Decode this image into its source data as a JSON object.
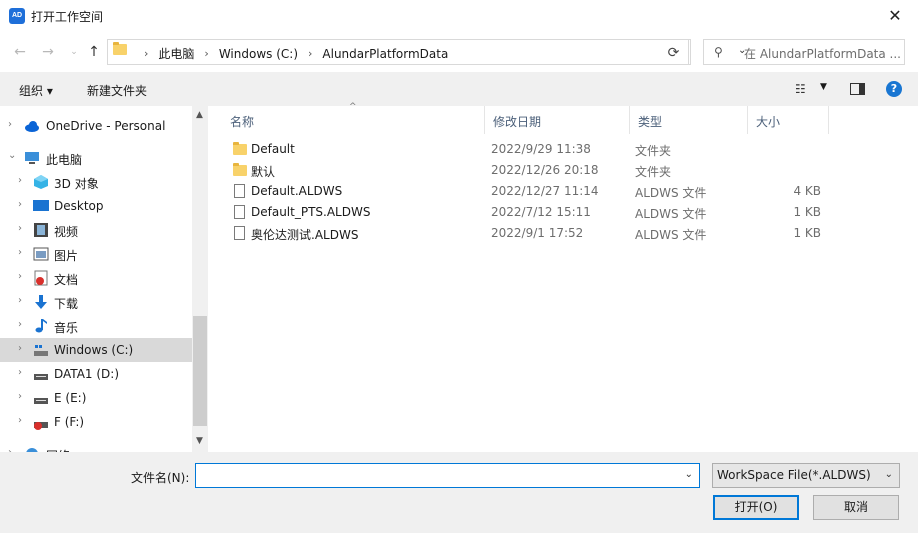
{
  "window": {
    "title": "打开工作空间",
    "app_badge": "AD",
    "close_glyph": "✕"
  },
  "nav": {
    "back": "←",
    "forward": "→",
    "up": "↑"
  },
  "address": {
    "crumbs": [
      "此电脑",
      "Windows (C:)",
      "AlundarPlatformData"
    ],
    "separator": "›",
    "refresh_glyph": "⟳"
  },
  "search": {
    "placeholder": "在 AlundarPlatformData ..."
  },
  "toolbar": {
    "organize": "组织 ▾",
    "new_folder": "新建文件夹",
    "help": "?"
  },
  "sidebar": {
    "items": [
      {
        "label": "OneDrive - Personal",
        "icon": "cloud-icon"
      },
      {
        "label": "此电脑",
        "icon": "computer-icon"
      },
      {
        "label": "3D 对象",
        "icon": "cube-icon"
      },
      {
        "label": "Desktop",
        "icon": "desktop-icon"
      },
      {
        "label": "视频",
        "icon": "video-icon"
      },
      {
        "label": "图片",
        "icon": "picture-icon"
      },
      {
        "label": "文档",
        "icon": "document-icon"
      },
      {
        "label": "下载",
        "icon": "download-icon"
      },
      {
        "label": "音乐",
        "icon": "music-icon"
      },
      {
        "label": "Windows (C:)",
        "icon": "drive-icon",
        "selected": true
      },
      {
        "label": "DATA1 (D:)",
        "icon": "drive-icon"
      },
      {
        "label": "E (E:)",
        "icon": "drive-icon"
      },
      {
        "label": "F (F:)",
        "icon": "drive-icon"
      },
      {
        "label": "网络",
        "icon": "network-icon"
      }
    ]
  },
  "columns": {
    "name": "名称",
    "modified": "修改日期",
    "type": "类型",
    "size": "大小"
  },
  "files": [
    {
      "name": "Default",
      "modified": "2022/9/29 11:38",
      "type": "文件夹",
      "size": "",
      "kind": "folder"
    },
    {
      "name": "默认",
      "modified": "2022/12/26 20:18",
      "type": "文件夹",
      "size": "",
      "kind": "folder"
    },
    {
      "name": "Default.ALDWS",
      "modified": "2022/12/27 11:14",
      "type": "ALDWS 文件",
      "size": "4 KB",
      "kind": "file"
    },
    {
      "name": "Default_PTS.ALDWS",
      "modified": "2022/7/12 15:11",
      "type": "ALDWS 文件",
      "size": "1 KB",
      "kind": "file"
    },
    {
      "name": "奥伦达测试.ALDWS",
      "modified": "2022/9/1 17:52",
      "type": "ALDWS 文件",
      "size": "1 KB",
      "kind": "file"
    }
  ],
  "bottom": {
    "filename_label": "文件名(N):",
    "filename_value": "",
    "filter": "WorkSpace File(*.ALDWS)",
    "open": "打开(O)",
    "cancel": "取消"
  },
  "colors": {
    "accent": "#0078d7",
    "selected_bg": "#d9d9d9",
    "toolbar_bg": "#f0f0f0"
  }
}
